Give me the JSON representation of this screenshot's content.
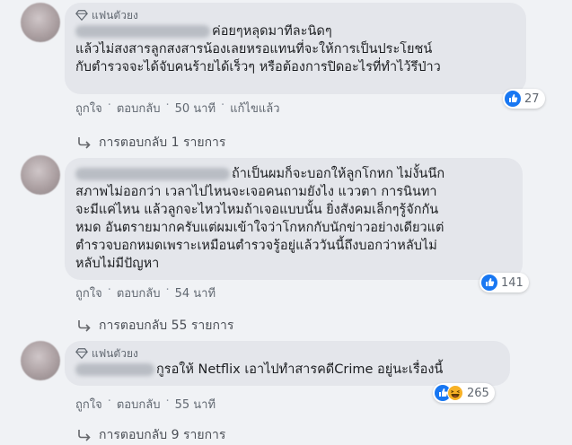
{
  "comments": [
    {
      "badge": "แฟนตัวยง",
      "lines": [
        "ค่อยๆหลุดมาทีละนิดๆ",
        "แล้วไม่สงสารลูกสงสารน้องเลยหรอแทนที่จะให้การเป็นประโยชน์",
        "กับตำรวจจะได้จับคนร้ายได้เร็วๆ หรือต้องการปิดอะไรที่ทำไว้รึป่าว"
      ],
      "actions": {
        "like": "ถูกใจ",
        "reply": "ตอบกลับ",
        "time": "50 นาที",
        "edited": "แก้ไขแล้ว"
      },
      "reaction_count": "27",
      "replies_label": "การตอบกลับ 1 รายการ"
    },
    {
      "lines": [
        "ถ้าเป็นผมก็จะบอกให้ลูกโกหก ไม่งั้นนึก",
        "สภาพไม่ออกว่า เวลาไปไหนจะเจอคนถามยังไง แววตา การนินทา",
        "จะมีแค่ไหน แล้วลูกจะไหวไหมถ้าเจอแบบนั้น ยิ่งสังคมเล็กๆรู้จักกัน",
        "หมด อันตรายมากครับแต่ผมเข้าใจว่าโกหกกับนักข่าวอย่างเดียวแต่",
        "ตำรวจบอกหมดเพราะเหมือนตำรวจรู้อยู่แล้ววันนี้ถึงบอกว่าหลับไม่",
        "หลับไม่มีปัญหา"
      ],
      "actions": {
        "like": "ถูกใจ",
        "reply": "ตอบกลับ",
        "time": "54 นาที"
      },
      "reaction_count": "141",
      "replies_label": "การตอบกลับ 55 รายการ"
    },
    {
      "badge": "แฟนตัวยง",
      "lines": [
        "กูรอให้ Netflix เอาไปทำสารคดีCrime อยู่นะเรื่องนี้"
      ],
      "actions": {
        "like": "ถูกใจ",
        "reply": "ตอบกลับ",
        "time": "55 นาที"
      },
      "reaction_count": "265",
      "replies_label": "การตอบกลับ 9 รายการ"
    }
  ],
  "colors": {
    "like_blue": "#1877f2",
    "haha_yellow": "#f7b125",
    "bubble": "#e4e6eb",
    "bg": "#f0f2f5"
  }
}
